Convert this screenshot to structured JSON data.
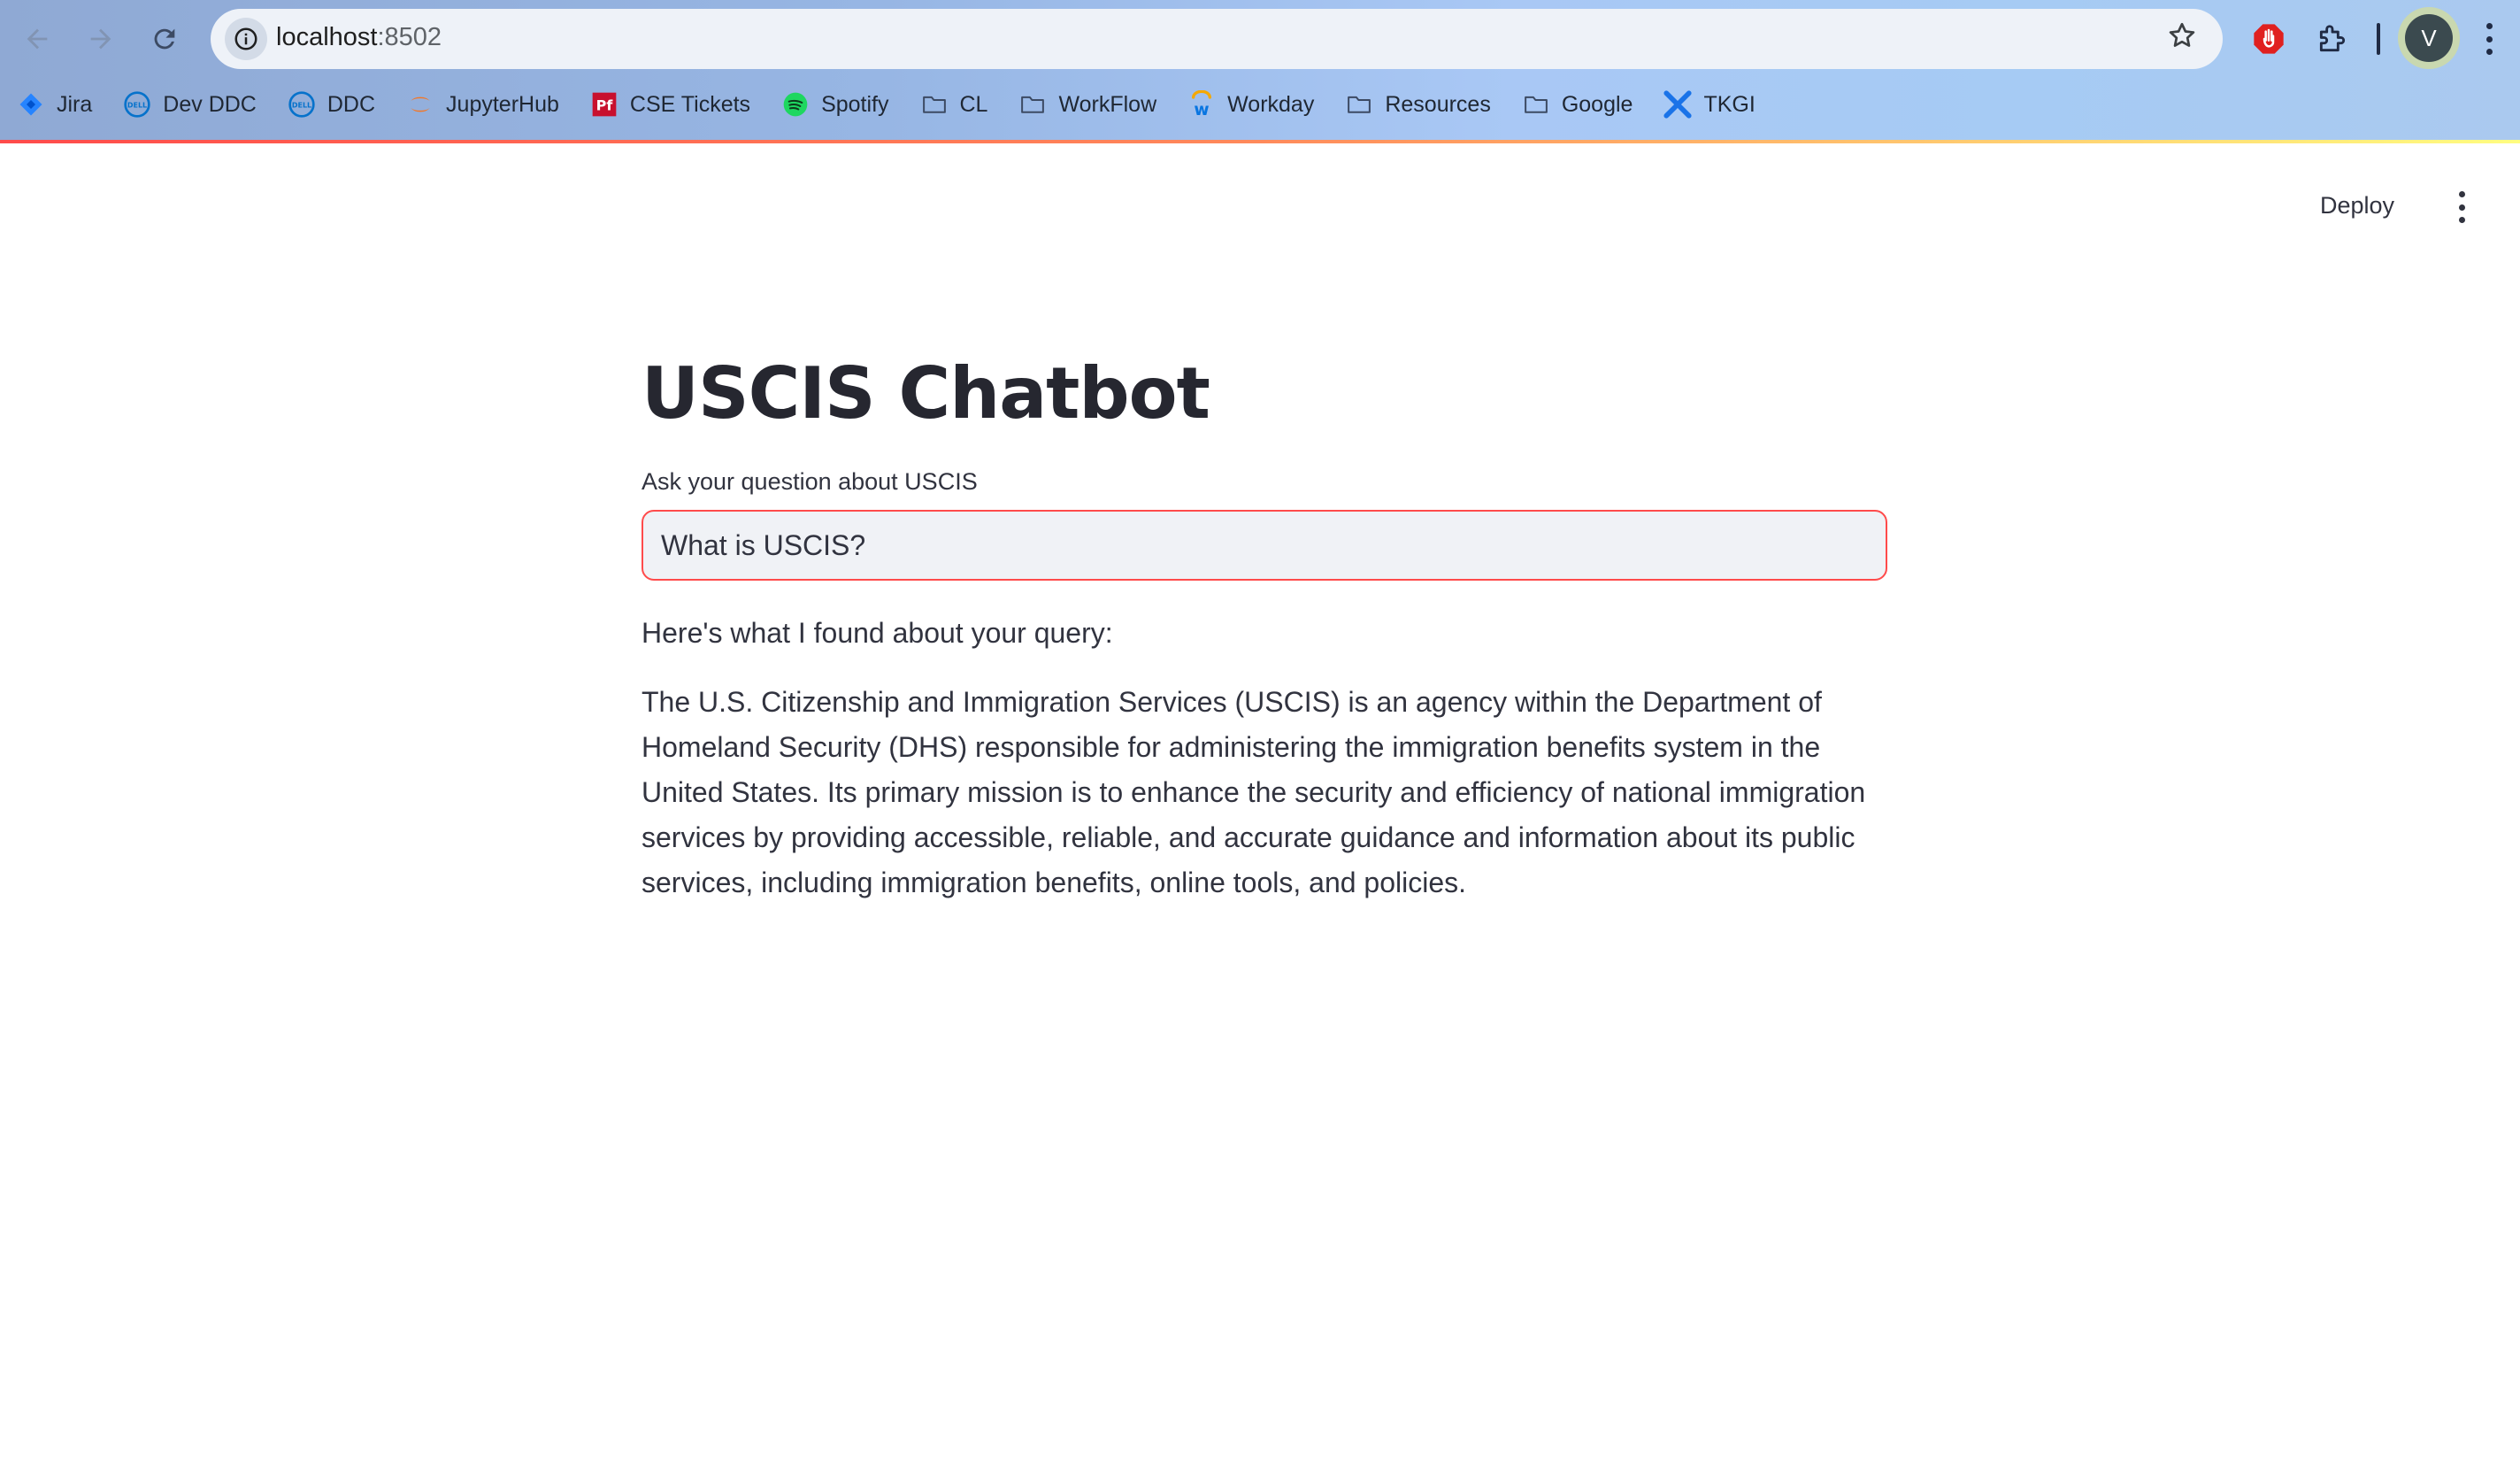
{
  "browser": {
    "url_host": "localhost",
    "url_port": ":8502",
    "profile_initial": "V",
    "bookmarks": [
      {
        "label": "Jira",
        "icon": "jira-icon"
      },
      {
        "label": "Dev DDC",
        "icon": "dell-icon"
      },
      {
        "label": "DDC",
        "icon": "dell-icon"
      },
      {
        "label": "JupyterHub",
        "icon": "jupyter-icon"
      },
      {
        "label": "CSE Tickets",
        "icon": "pf-icon"
      },
      {
        "label": "Spotify",
        "icon": "spotify-icon"
      },
      {
        "label": "CL",
        "icon": "folder-icon"
      },
      {
        "label": "WorkFlow",
        "icon": "folder-icon"
      },
      {
        "label": "Workday",
        "icon": "workday-icon"
      },
      {
        "label": "Resources",
        "icon": "folder-icon"
      },
      {
        "label": "Google",
        "icon": "folder-icon"
      },
      {
        "label": "TKGI",
        "icon": "tkgi-icon"
      }
    ]
  },
  "app": {
    "deploy_label": "Deploy",
    "title": "USCIS Chatbot",
    "input_label": "Ask your question about USCIS",
    "input_value": "What is USCIS?",
    "lead_text": "Here's what I found about your query:",
    "answer_text": "The U.S. Citizenship and Immigration Services (USCIS) is an agency within the Department of Homeland Security (DHS) responsible for administering the immigration benefits system in the United States. Its primary mission is to enhance the security and efficiency of national immigration services by providing accessible, reliable, and accurate guidance and information about its public services, including immigration benefits, online tools, and policies."
  },
  "colors": {
    "accent": "#ff4b4b",
    "text": "#31333f",
    "input_bg": "#f0f2f6"
  }
}
